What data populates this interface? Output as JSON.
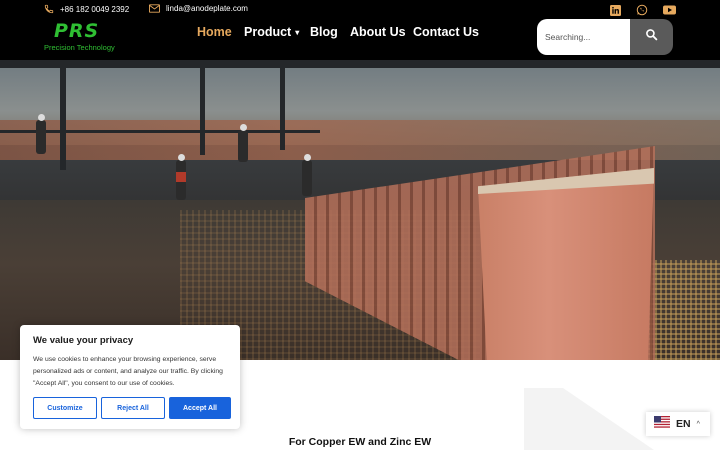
{
  "topbar": {
    "phone": "+86 182 0049 2392",
    "email": "linda@anodeplate.com",
    "social_icons": [
      "linkedin-icon",
      "whatsapp-icon",
      "youtube-icon"
    ]
  },
  "logo": {
    "mark": "PRS",
    "tagline": "Precision Technology"
  },
  "nav": {
    "items": [
      {
        "label": "Home",
        "active": true
      },
      {
        "label": "Product",
        "has_dropdown": true
      },
      {
        "label": "Blog"
      },
      {
        "label": "About Us"
      },
      {
        "label": "Contact Us"
      }
    ]
  },
  "search": {
    "placeholder": "Searching..."
  },
  "cookie": {
    "title": "We value your privacy",
    "text": "We use cookies to enhance your browsing experience, serve personalized ads or content, and analyze our traffic. By clicking \"Accept All\", you consent to our use of cookies.",
    "customize": "Customize",
    "reject": "Reject All",
    "accept": "Accept All"
  },
  "section": {
    "subtitle": "For Copper EW and Zinc EW"
  },
  "language": {
    "code": "EN"
  },
  "colors": {
    "accent": "#e6a95e",
    "brand_green": "#2fbf33",
    "cookie_blue": "#1863dc",
    "header_bg": "#000000"
  }
}
